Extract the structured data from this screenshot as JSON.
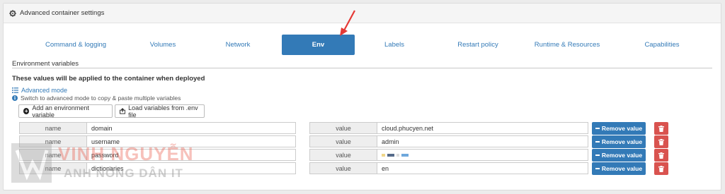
{
  "panel": {
    "title": "Advanced container settings",
    "icon": "gear-icon"
  },
  "tabs": [
    {
      "label": "Command & logging"
    },
    {
      "label": "Volumes"
    },
    {
      "label": "Network"
    },
    {
      "label": "Env"
    },
    {
      "label": "Labels"
    },
    {
      "label": "Restart policy"
    },
    {
      "label": "Runtime & Resources"
    },
    {
      "label": "Capabilities"
    }
  ],
  "active_tab": "Env",
  "env": {
    "section_title": "Environment variables",
    "notice": "These values will be applied to the container when deployed",
    "advanced_mode_label": "Advanced mode",
    "advanced_mode_help": "Switch to advanced mode to copy & paste multiple variables",
    "add_button_label": "Add an environment variable",
    "load_button_label": "Load variables from .env file",
    "name_label": "name",
    "value_label": "value",
    "remove_label": "Remove value",
    "variables": [
      {
        "name": "domain",
        "value": "cloud.phucyen.net"
      },
      {
        "name": "username",
        "value": "admin"
      },
      {
        "name": "password",
        "value": ""
      },
      {
        "name": "dictionaries",
        "value": "en"
      }
    ]
  },
  "watermark": {
    "line1": "VINH NGUYỄN",
    "line2": "ANH NÔNG DÂN IT"
  },
  "colors": {
    "primary": "#337ab7",
    "danger": "#d9534f",
    "arrow": "#e53935"
  }
}
